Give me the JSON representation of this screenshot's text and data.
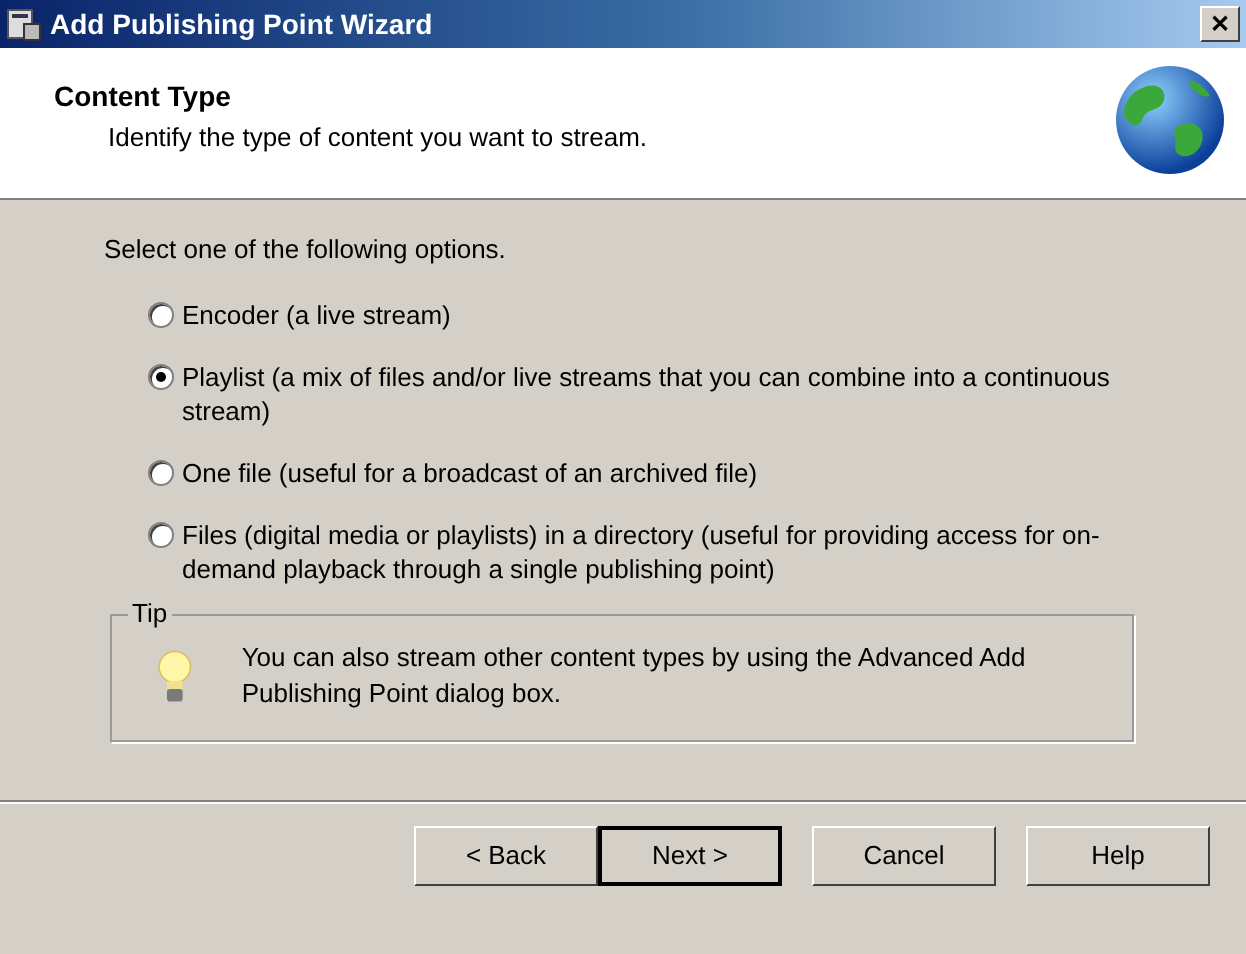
{
  "window": {
    "title": "Add Publishing Point Wizard",
    "close": "✕"
  },
  "header": {
    "title": "Content Type",
    "subtitle": "Identify the type of content you want to stream."
  },
  "prompt": "Select one of the following options.",
  "options": [
    {
      "label": "Encoder (a live stream)",
      "selected": false
    },
    {
      "label": "Playlist (a mix of files and/or live streams that you can combine into a continuous stream)",
      "selected": true
    },
    {
      "label": "One file (useful for a broadcast of an archived file)",
      "selected": false
    },
    {
      "label": "Files (digital media or playlists) in a directory (useful for providing access for on-demand playback through a single publishing point)",
      "selected": false
    }
  ],
  "tip": {
    "title": "Tip",
    "text": "You can also stream other content types by using the Advanced Add Publishing Point dialog box."
  },
  "buttons": [
    {
      "label": "< Back",
      "default": false
    },
    {
      "label": "Next >",
      "default": true
    },
    {
      "label": "Cancel",
      "default": false
    },
    {
      "label": "Help",
      "default": false
    }
  ]
}
